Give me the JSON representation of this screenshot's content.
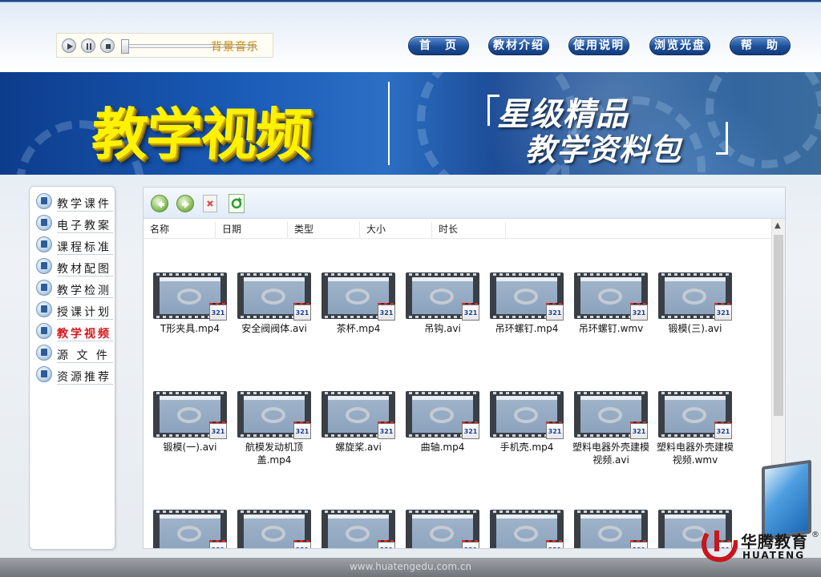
{
  "player": {
    "music_label": "背景音乐",
    "play_icon": "play-icon",
    "pause_icon": "pause-icon",
    "stop_icon": "stop-icon"
  },
  "nav": [
    {
      "label": "首　页"
    },
    {
      "label": "教材介绍"
    },
    {
      "label": "使用说明"
    },
    {
      "label": "浏览光盘"
    },
    {
      "label": "帮　助"
    }
  ],
  "banner": {
    "title": "教学视频",
    "slogan_line1": "星级精品",
    "slogan_line2": "教学资料包"
  },
  "sidebar": {
    "items": [
      {
        "label": "教学课件",
        "active": false
      },
      {
        "label": "电子教案",
        "active": false
      },
      {
        "label": "课程标准",
        "active": false
      },
      {
        "label": "教材配图",
        "active": false
      },
      {
        "label": "教学检测",
        "active": false
      },
      {
        "label": "授课计划",
        "active": false
      },
      {
        "label": "教学视频",
        "active": true
      },
      {
        "label": "源 文 件",
        "active": false
      },
      {
        "label": "资源推荐",
        "active": false
      }
    ]
  },
  "browser": {
    "columns": [
      "名称",
      "日期",
      "类型",
      "大小",
      "时长"
    ],
    "badge": "321",
    "files": [
      {
        "name": "T形夹具.mp4"
      },
      {
        "name": "安全阀阀体.avi"
      },
      {
        "name": "茶杯.mp4"
      },
      {
        "name": "吊钩.avi"
      },
      {
        "name": "吊环螺钉.mp4"
      },
      {
        "name": "吊环螺钉.wmv"
      },
      {
        "name": "锻模(三).avi"
      },
      {
        "name": "锻模(一).avi"
      },
      {
        "name": "航模发动机顶盖.mp4"
      },
      {
        "name": "螺旋桨.avi"
      },
      {
        "name": "曲轴.mp4"
      },
      {
        "name": "手机壳.mp4"
      },
      {
        "name": "塑料电器外壳建模视频.avi"
      },
      {
        "name": "塑料电器外壳建模视频.wmv"
      }
    ]
  },
  "footer": {
    "url": "www.huatengedu.com.cn"
  },
  "logo": {
    "cn": "华腾教育",
    "en": "HUATENG",
    "reg": "®"
  },
  "colors": {
    "active_sidebar": "#d4181c",
    "nav_blue": "#1d4f9a",
    "music_label": "#c8860a"
  }
}
